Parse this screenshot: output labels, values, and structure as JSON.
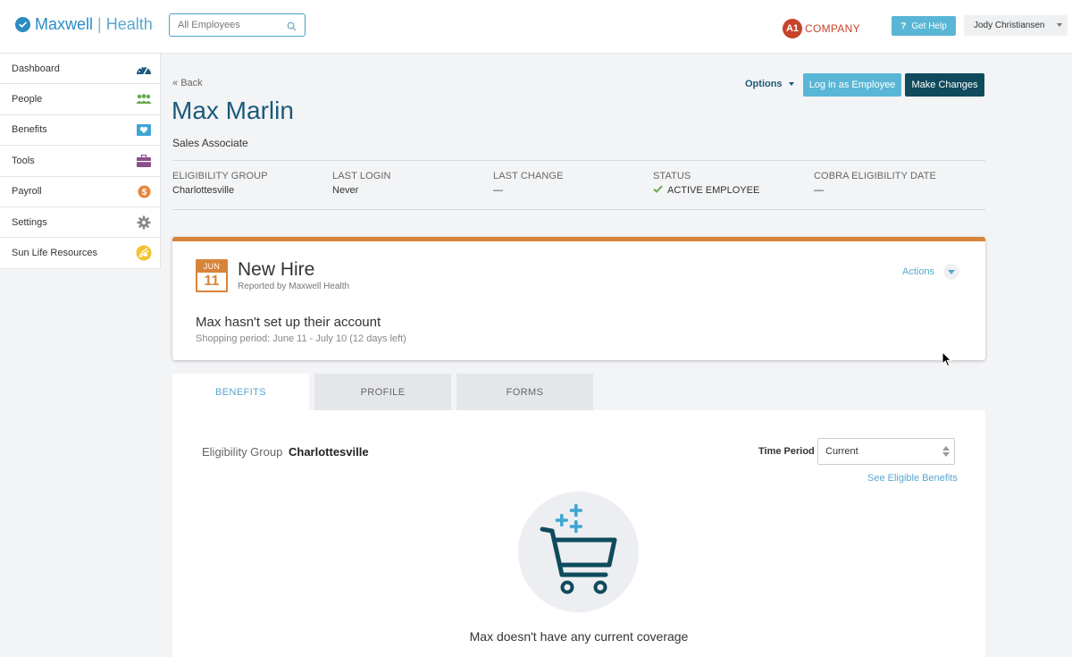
{
  "brand": {
    "name": "Maxwell",
    "suffix": "Health",
    "tm": "."
  },
  "search": {
    "placeholder": "All Employees"
  },
  "company": {
    "badge": "A1",
    "name": "COMPANY"
  },
  "header": {
    "help_label": "Get Help",
    "user_name": "Jody Christiansen"
  },
  "sidebar": {
    "items": [
      {
        "label": "Dashboard",
        "icon": "dashboard-gauge-icon"
      },
      {
        "label": "People",
        "icon": "people-icon"
      },
      {
        "label": "Benefits",
        "icon": "benefits-heart-icon"
      },
      {
        "label": "Tools",
        "icon": "toolbox-icon"
      },
      {
        "label": "Payroll",
        "icon": "dollar-coin-icon"
      },
      {
        "label": "Settings",
        "icon": "gear-icon"
      },
      {
        "label": "Sun Life Resources",
        "icon": "sun-life-icon"
      }
    ]
  },
  "page": {
    "back_label": "Back",
    "employee_name": "Max Marlin",
    "job_title": "Sales Associate",
    "options_label": "Options",
    "login_label": "Log in as Employee",
    "make_changes_label": "Make Changes"
  },
  "meta": {
    "eligibility_group": {
      "label": "ELIGIBILITY GROUP",
      "value": "Charlottesville"
    },
    "last_login": {
      "label": "LAST LOGIN",
      "value": "Never"
    },
    "last_change": {
      "label": "LAST CHANGE",
      "value": "—"
    },
    "status": {
      "label": "STATUS",
      "value": "ACTIVE EMPLOYEE"
    },
    "cobra": {
      "label": "COBRA ELIGIBILITY DATE",
      "value": "—"
    }
  },
  "event": {
    "month": "JUN",
    "day": "11",
    "title": "New Hire",
    "reported_by": "Reported by Maxwell Health",
    "actions_label": "Actions",
    "message": "Max hasn't set up their account",
    "shopping_period": "Shopping period: June 11 - July 10 (12 days left)"
  },
  "tabs": [
    {
      "label": "BENEFITS",
      "active": true
    },
    {
      "label": "PROFILE",
      "active": false
    },
    {
      "label": "FORMS",
      "active": false
    }
  ],
  "benefits": {
    "eligibility_label": "Eligibility Group",
    "eligibility_value": "Charlottesville",
    "time_period_label": "Time Period",
    "time_period_value": "Current",
    "see_eligible_label": "See Eligible Benefits",
    "empty_message": "Max doesn't have any current coverage"
  },
  "colors": {
    "brand_blue": "#2b8cc4",
    "title_navy": "#1b5a7a",
    "accent_light_blue": "#5ab6d6",
    "dark_button": "#0f4b5d",
    "event_orange": "#d8843a",
    "company_red": "#c8432b",
    "status_green": "#6aa84f"
  }
}
